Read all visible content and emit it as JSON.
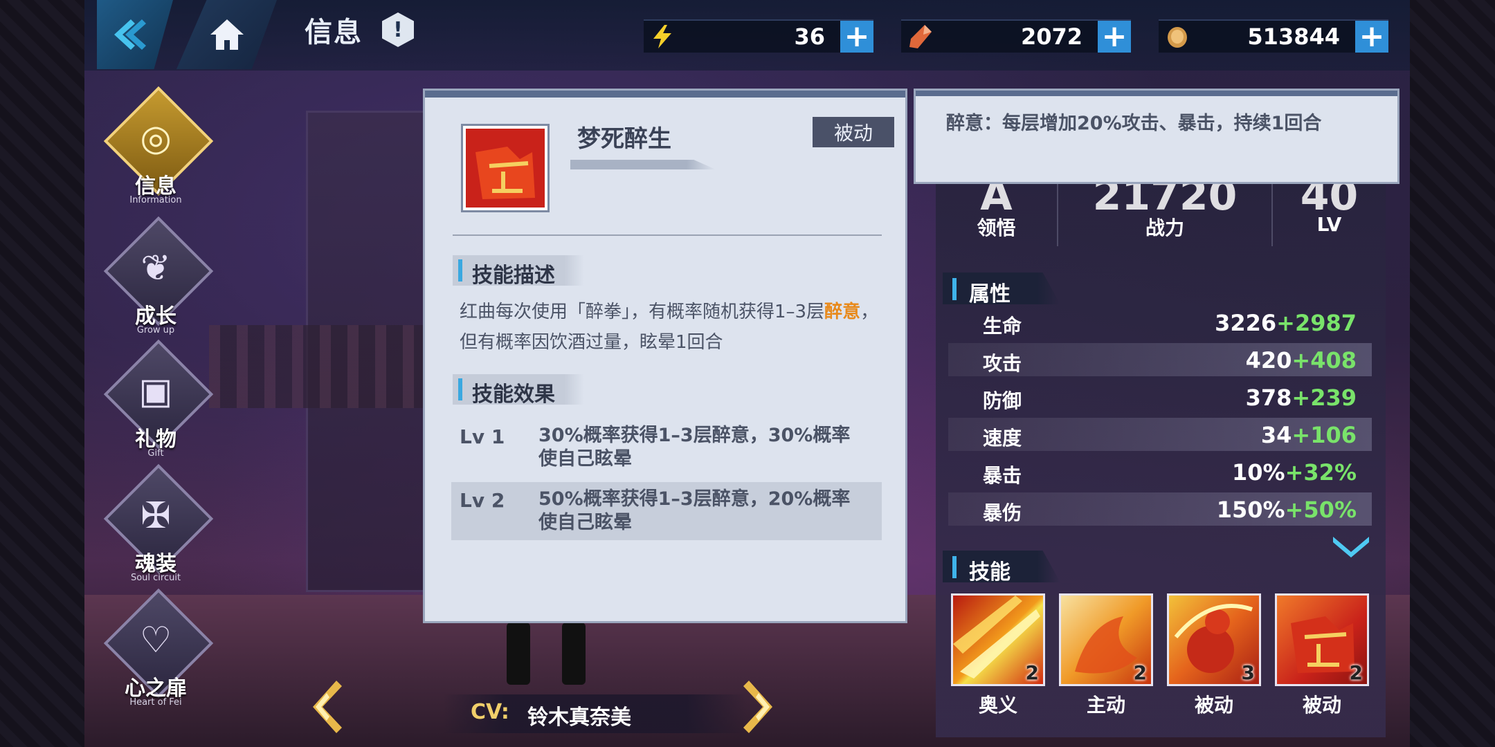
{
  "header": {
    "title": "信息",
    "resources": [
      {
        "icon": "lightning-icon",
        "value": "36"
      },
      {
        "icon": "crystal-icon",
        "value": "2072"
      },
      {
        "icon": "coin-icon",
        "value": "513844"
      }
    ]
  },
  "nav": [
    {
      "label": "信息",
      "sub": "Information",
      "glyph": "◎",
      "icon": "information-icon",
      "active": true
    },
    {
      "label": "成长",
      "sub": "Grow up",
      "glyph": "❦",
      "icon": "wings-icon",
      "active": false
    },
    {
      "label": "礼物",
      "sub": "Gift",
      "glyph": "▣",
      "icon": "gift-icon",
      "active": false
    },
    {
      "label": "魂装",
      "sub": "Soul circuit",
      "glyph": "✠",
      "icon": "soul-circuit-icon",
      "active": false
    },
    {
      "label": "心之扉",
      "sub": "Heart of Fei",
      "glyph": "♡",
      "icon": "heart-door-icon",
      "active": false
    }
  ],
  "skill_detail": {
    "name": "梦死醉生",
    "tag": "被动",
    "desc_heading": "技能描述",
    "desc_before": "红曲每次使用「醉拳」，有概率随机获得1–3层",
    "desc_highlight": "醉意",
    "desc_after": "，但有概率因饮酒过量，眩晕1回合",
    "effect_heading": "技能效果",
    "effects": [
      {
        "lv": "Lv  1",
        "text": "30%概率获得1–3层醉意，30%概率使自己眩晕"
      },
      {
        "lv": "Lv  2",
        "text": "50%概率获得1–3层醉意，20%概率使自己眩晕"
      }
    ]
  },
  "tooltip": {
    "text": "醉意：每层增加20%攻击、暴击，持续1回合"
  },
  "summary": [
    {
      "value": "A",
      "label": "领悟"
    },
    {
      "value": "21720",
      "label": "战力"
    },
    {
      "value": "40",
      "label": "LV"
    }
  ],
  "attributes": {
    "heading": "属性",
    "rows": [
      {
        "name": "生命",
        "base": "3226",
        "bonus": "+2987"
      },
      {
        "name": "攻击",
        "base": "420",
        "bonus": "+408"
      },
      {
        "name": "防御",
        "base": "378",
        "bonus": "+239"
      },
      {
        "name": "速度",
        "base": "34",
        "bonus": "+106"
      },
      {
        "name": "暴击",
        "base": "10%",
        "bonus": "+32%"
      },
      {
        "name": "暴伤",
        "base": "150%",
        "bonus": "+50%"
      }
    ]
  },
  "skills": {
    "heading": "技能",
    "items": [
      {
        "type": "奥义",
        "level": "2",
        "icon": "lightning-slash-icon"
      },
      {
        "type": "主动",
        "level": "2",
        "icon": "flame-fist-icon"
      },
      {
        "type": "被动",
        "level": "3",
        "icon": "wine-gourd-icon"
      },
      {
        "type": "被动",
        "level": "2",
        "icon": "drunken-fist-icon"
      }
    ]
  },
  "cv": {
    "label": "CV:",
    "name": "铃木真奈美"
  },
  "colors": {
    "accent_blue": "#2f8fd8",
    "highlight_orange": "#e88a1c",
    "bonus_green": "#79e36a",
    "gold": "#f2cf6a"
  }
}
